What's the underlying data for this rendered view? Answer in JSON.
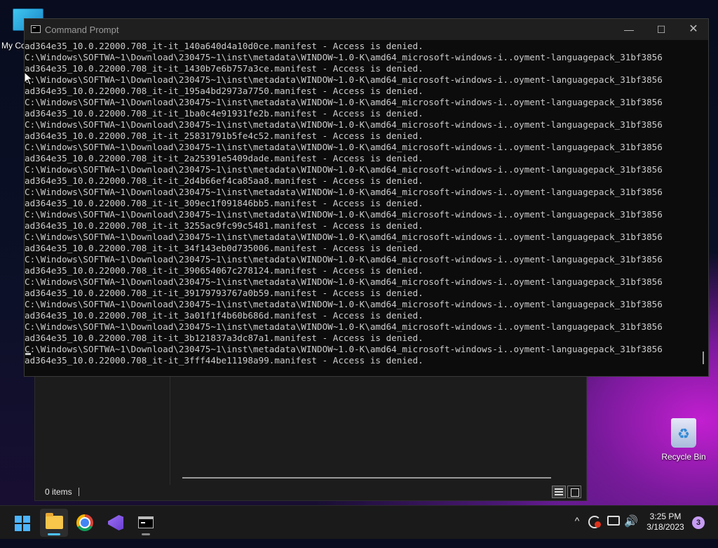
{
  "desktop": {
    "icons": [
      {
        "label": "My Co"
      },
      {
        "label": "Recycle Bin"
      }
    ]
  },
  "explorer": {
    "status_items": "0 items"
  },
  "cmd": {
    "title": "Command Prompt",
    "controls": {
      "minimize": "—",
      "maximize": "☐",
      "close": "✕"
    },
    "output": [
      "ad364e35_10.0.22000.708_it-it_140a640d4a10d0ce.manifest - Access is denied.",
      "C:\\Windows\\SOFTWA~1\\Download\\230475~1\\inst\\metadata\\WINDOW~1.0-K\\amd64_microsoft-windows-i..oyment-languagepack_31bf3856",
      "ad364e35_10.0.22000.708_it-it_1430b7e6b757a3ce.manifest - Access is denied.",
      "C:\\Windows\\SOFTWA~1\\Download\\230475~1\\inst\\metadata\\WINDOW~1.0-K\\amd64_microsoft-windows-i..oyment-languagepack_31bf3856",
      "ad364e35_10.0.22000.708_it-it_195a4bd2973a7750.manifest - Access is denied.",
      "C:\\Windows\\SOFTWA~1\\Download\\230475~1\\inst\\metadata\\WINDOW~1.0-K\\amd64_microsoft-windows-i..oyment-languagepack_31bf3856",
      "ad364e35_10.0.22000.708_it-it_1ba0c4e91931fe2b.manifest - Access is denied.",
      "C:\\Windows\\SOFTWA~1\\Download\\230475~1\\inst\\metadata\\WINDOW~1.0-K\\amd64_microsoft-windows-i..oyment-languagepack_31bf3856",
      "ad364e35_10.0.22000.708_it-it_25831791b5fe4c52.manifest - Access is denied.",
      "C:\\Windows\\SOFTWA~1\\Download\\230475~1\\inst\\metadata\\WINDOW~1.0-K\\amd64_microsoft-windows-i..oyment-languagepack_31bf3856",
      "ad364e35_10.0.22000.708_it-it_2a25391e5409dade.manifest - Access is denied.",
      "C:\\Windows\\SOFTWA~1\\Download\\230475~1\\inst\\metadata\\WINDOW~1.0-K\\amd64_microsoft-windows-i..oyment-languagepack_31bf3856",
      "ad364e35_10.0.22000.708_it-it_2d4b66ef4ca85aa8.manifest - Access is denied.",
      "C:\\Windows\\SOFTWA~1\\Download\\230475~1\\inst\\metadata\\WINDOW~1.0-K\\amd64_microsoft-windows-i..oyment-languagepack_31bf3856",
      "ad364e35_10.0.22000.708_it-it_309ec1f091846bb5.manifest - Access is denied.",
      "C:\\Windows\\SOFTWA~1\\Download\\230475~1\\inst\\metadata\\WINDOW~1.0-K\\amd64_microsoft-windows-i..oyment-languagepack_31bf3856",
      "ad364e35_10.0.22000.708_it-it_3255ac9fc99c5481.manifest - Access is denied.",
      "C:\\Windows\\SOFTWA~1\\Download\\230475~1\\inst\\metadata\\WINDOW~1.0-K\\amd64_microsoft-windows-i..oyment-languagepack_31bf3856",
      "ad364e35_10.0.22000.708_it-it_34f143eb0d735006.manifest - Access is denied.",
      "C:\\Windows\\SOFTWA~1\\Download\\230475~1\\inst\\metadata\\WINDOW~1.0-K\\amd64_microsoft-windows-i..oyment-languagepack_31bf3856",
      "ad364e35_10.0.22000.708_it-it_390654067c278124.manifest - Access is denied.",
      "C:\\Windows\\SOFTWA~1\\Download\\230475~1\\inst\\metadata\\WINDOW~1.0-K\\amd64_microsoft-windows-i..oyment-languagepack_31bf3856",
      "ad364e35_10.0.22000.708_it-it_39179793767a0b59.manifest - Access is denied.",
      "C:\\Windows\\SOFTWA~1\\Download\\230475~1\\inst\\metadata\\WINDOW~1.0-K\\amd64_microsoft-windows-i..oyment-languagepack_31bf3856",
      "ad364e35_10.0.22000.708_it-it_3a01f1f4b60b686d.manifest - Access is denied.",
      "C:\\Windows\\SOFTWA~1\\Download\\230475~1\\inst\\metadata\\WINDOW~1.0-K\\amd64_microsoft-windows-i..oyment-languagepack_31bf3856",
      "ad364e35_10.0.22000.708_it-it_3b121837a3dc87a1.manifest - Access is denied.",
      "C:\\Windows\\SOFTWA~1\\Download\\230475~1\\inst\\metadata\\WINDOW~1.0-K\\amd64_microsoft-windows-i..oyment-languagepack_31bf3856",
      "ad364e35_10.0.22000.708_it-it_3fff44be11198a99.manifest - Access is denied."
    ]
  },
  "taskbar": {
    "icons": [
      "windows-start-icon",
      "file-explorer-icon",
      "chrome-icon",
      "visual-studio-icon",
      "command-prompt-icon"
    ],
    "tray": {
      "chevron": "^",
      "speaker": "🔊",
      "time": "3:25 PM",
      "date": "3/18/2023",
      "notification_count": "3"
    }
  },
  "colors": {
    "accent": "#4cc2ff",
    "console_text": "#cccccc",
    "console_bg": "#0c0c0c",
    "network_error": "#e0321c"
  }
}
